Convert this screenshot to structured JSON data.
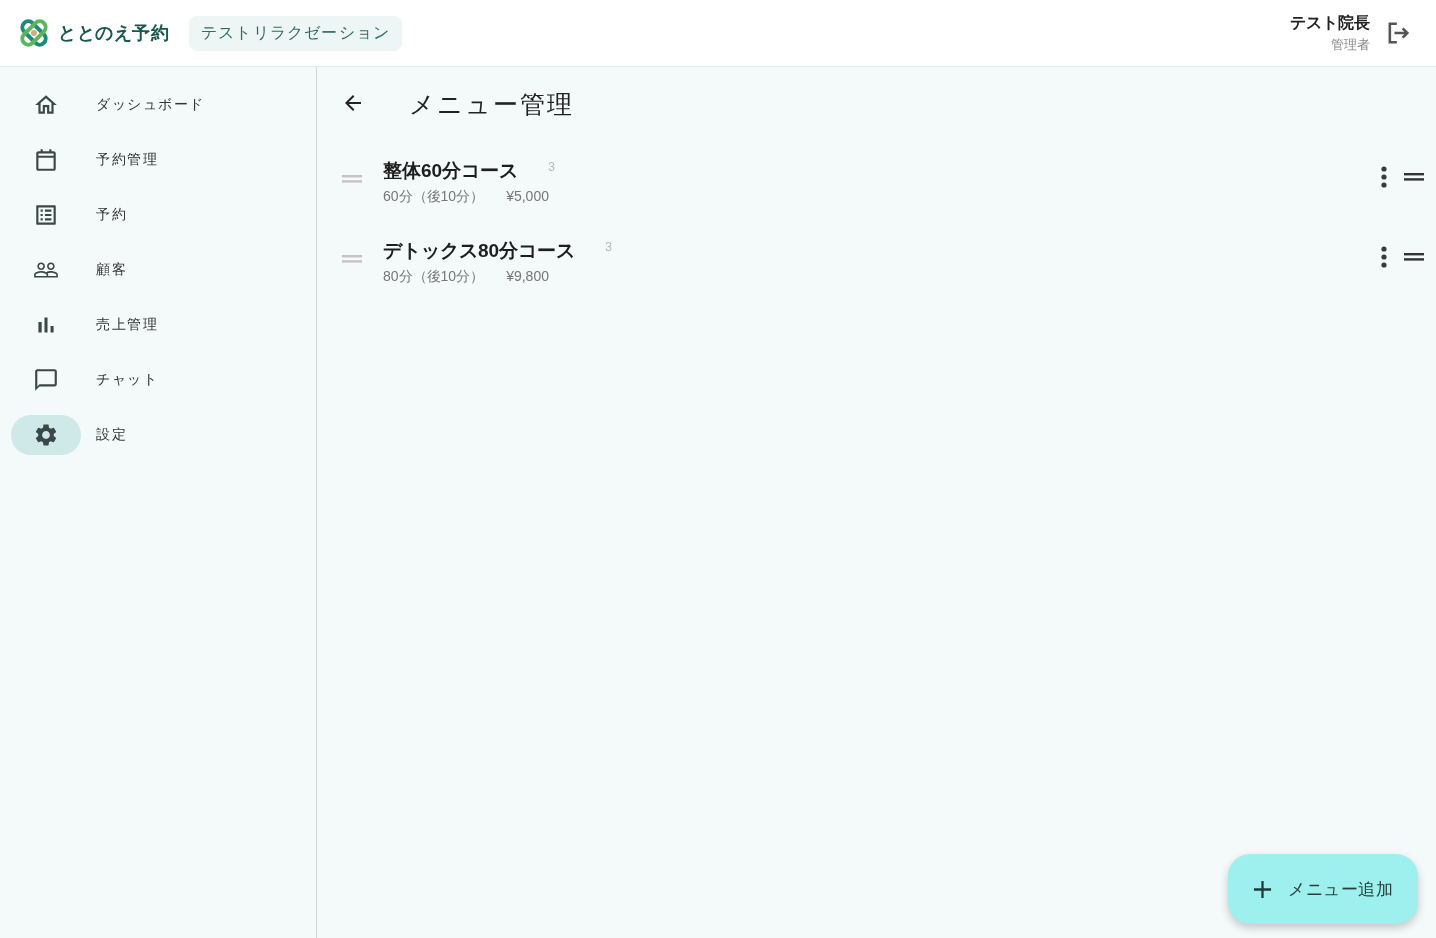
{
  "header": {
    "logo_text": "ととのえ予約",
    "shop_badge": "テストリラクゼーション",
    "user": {
      "name": "テスト院長",
      "role": "管理者"
    }
  },
  "sidebar": {
    "items": [
      {
        "kind": "dashboard",
        "label": "ダッシュボード",
        "selected": false
      },
      {
        "kind": "calendar",
        "label": "予約管理",
        "selected": false
      },
      {
        "kind": "list",
        "label": "予約",
        "selected": false
      },
      {
        "kind": "customers",
        "label": "顧客",
        "selected": false
      },
      {
        "kind": "sales",
        "label": "売上管理",
        "selected": false
      },
      {
        "kind": "chat",
        "label": "チャット",
        "selected": false
      },
      {
        "kind": "settings",
        "label": "設定",
        "selected": true
      }
    ]
  },
  "page": {
    "title": "メニュー管理"
  },
  "menus": [
    {
      "title": "整体60分コース",
      "count": "3",
      "duration": "60分（後10分）",
      "price": "¥5,000"
    },
    {
      "title": "デトックス80分コース",
      "count": "3",
      "duration": "80分（後10分）",
      "price": "¥9,800"
    }
  ],
  "fab": {
    "label": "メニュー追加"
  }
}
